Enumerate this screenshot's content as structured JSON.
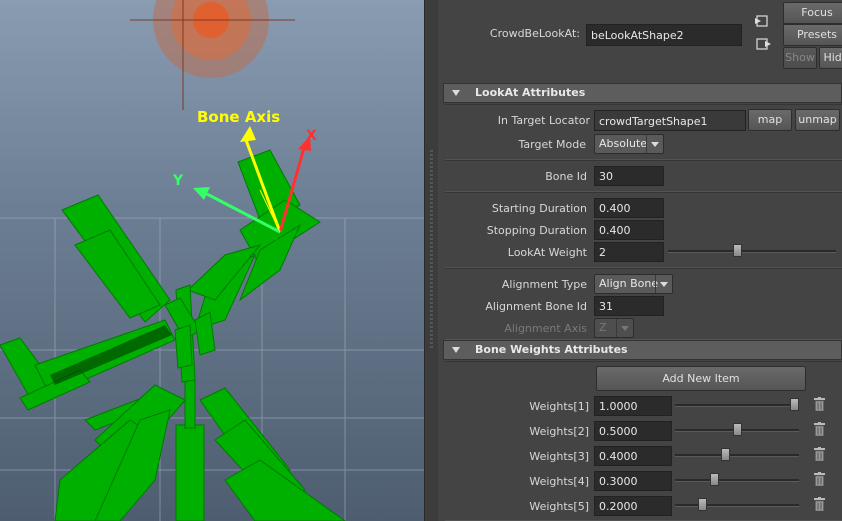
{
  "viewport": {
    "annotation": "Bone Axis",
    "axes": {
      "x": "X",
      "y": "Y"
    }
  },
  "header": {
    "node_label": "CrowdBeLookAt:",
    "node_value": "beLookAtShape2",
    "focus_label": "Focus",
    "presets_label": "Presets",
    "show_label": "Show",
    "hide_label": "Hide"
  },
  "lookat": {
    "title": "LookAt Attributes",
    "target_locator_label": "In Target Locator",
    "target_locator_value": "crowdTargetShape1",
    "map_label": "map",
    "unmap_label": "unmap",
    "target_mode_label": "Target Mode",
    "target_mode_value": "Absolute",
    "bone_id_label": "Bone Id",
    "bone_id_value": "30",
    "starting_duration_label": "Starting Duration",
    "starting_duration_value": "0.400",
    "stopping_duration_label": "Stopping Duration",
    "stopping_duration_value": "0.400",
    "lookat_weight_label": "LookAt Weight",
    "lookat_weight_value": "2",
    "lookat_weight_slider": 0.41,
    "alignment_type_label": "Alignment Type",
    "alignment_type_value": "Align Bone",
    "alignment_bone_id_label": "Alignment Bone Id",
    "alignment_bone_id_value": "31",
    "alignment_axis_label": "Alignment Axis",
    "alignment_axis_value": "Z"
  },
  "bone_weights": {
    "title": "Bone Weights Attributes",
    "add_new_item_label": "Add New Item",
    "items": [
      {
        "label": "Weights[1]",
        "value": "1.0000",
        "level": 1.0
      },
      {
        "label": "Weights[2]",
        "value": "0.5000",
        "level": 0.5
      },
      {
        "label": "Weights[3]",
        "value": "0.4000",
        "level": 0.4
      },
      {
        "label": "Weights[4]",
        "value": "0.3000",
        "level": 0.3
      },
      {
        "label": "Weights[5]",
        "value": "0.2000",
        "level": 0.2
      }
    ]
  },
  "colors": {
    "axis_x": "#ff3030",
    "axis_y": "#33ff66",
    "bone_axis": "#ffff00",
    "mesh": "#00aa00",
    "target": "#e06030"
  }
}
